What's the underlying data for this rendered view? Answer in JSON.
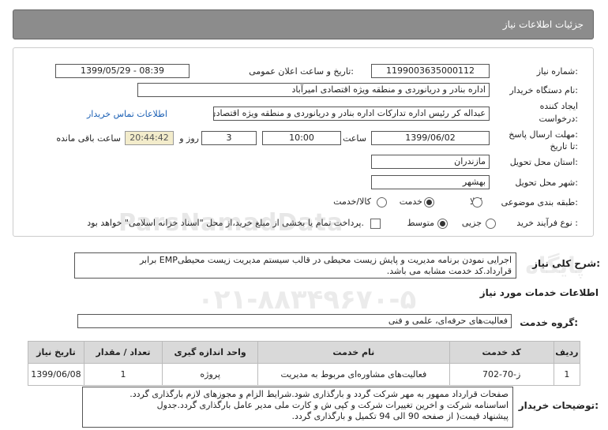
{
  "header": {
    "title": "جزئیات اطلاعات نیاز"
  },
  "form": {
    "need_number_label": "شماره نیاز:",
    "need_number": "1199003635000112",
    "announce_label": "تاریخ و ساعت اعلان عمومی:",
    "announce_value": "1399/05/29 - 08:39",
    "buyer_label": "نام دستگاه خریدار:",
    "buyer_value": "اداره بنادر و دریانوردی و منطقه ویژه اقتصادی امیرآباد",
    "creator_label_1": "ایجاد کننده",
    "creator_label_2": "درخواست:",
    "creator_value": "عبداله کر رئیس اداره تداركات اداره بنادر و دریانوردی و منطقه ویژه اقتصادی امیرآباد",
    "contact_link": "اطلاعات تماس خریدار",
    "deadline_label_1": "مهلت ارسال پاسخ:",
    "deadline_label_2": "تا تاریخ:",
    "deadline_date": "1399/06/02",
    "time_label": "ساعت",
    "deadline_time": "10:00",
    "day_label": "روز و",
    "days_value": "3",
    "countdown": "20:44:42",
    "remaining_label": "ساعت باقی مانده",
    "province_label": "استان محل تحویل:",
    "province_value": "مازندران",
    "city_label": "شهر محل تحویل:",
    "city_value": "بهشهر",
    "category_label": "طبقه بندی موضوعی:",
    "category_options": [
      "کالا",
      "خدمت",
      "کالا/خدمت"
    ],
    "category_selected": "خدمت",
    "process_label": "نوع فرآیند خرید :",
    "process_options": [
      "جزیی",
      "متوسط"
    ],
    "process_selected": "متوسط",
    "payment_note": "پرداخت تمام یا بخشی از مبلغ خرید،از محل \"اسناد خزانه اسلامی\" خواهد بود."
  },
  "summary": {
    "label": "شرح کلی نیاز:",
    "line1": "اجرایی نمودن برنامه مدیریت و پایش زیست محیطی  در قالب سیستم مدیریت زیست محیطیEMP برابر",
    "line2": "قرارداد.کد خدمت مشابه می باشد."
  },
  "services": {
    "section_title": "اطلاعات خدمات مورد نیاز",
    "group_label": "گروه خدمت:",
    "group_value": "فعالیت‌های حرفه‌ای، علمی و فنی",
    "columns": [
      "ردیف",
      "کد خدمت",
      "نام خدمت",
      "واحد اندازه گیری",
      "تعداد / مقدار",
      "تاریخ نیاز"
    ],
    "rows": [
      [
        "1",
        "ز-70-702",
        "فعالیت‌های مشاوره‌ای مربوط به مدیریت",
        "پروژه",
        "1",
        "1399/06/08"
      ]
    ]
  },
  "buyer_notes": {
    "label": "توضیحات خریدار:",
    "line1": "صفحات قرارداد ممهور به مهر شرکت گردد و بارگذاری شود.شرایط الزام و مجوزهای لازم  بارگذاری گردد.",
    "line2": "اساسنامه شرکت و اخرین تغییرات شرکت و کپی ش و کارت ملی مدیر عامل بارگذاری گردد.جدول",
    "line3": "پیشنهاد قیمت( از صفحه 90 الی 94 تکمیل و بارگذاری گردد."
  },
  "watermark": {
    "line1": "ParsNamadData",
    "line2": "پایگاه اطلاع رسانی مناقصه و مزایده",
    "line3": "۰۲۱-۸۸۳۴۹۶۷۰-۵"
  }
}
